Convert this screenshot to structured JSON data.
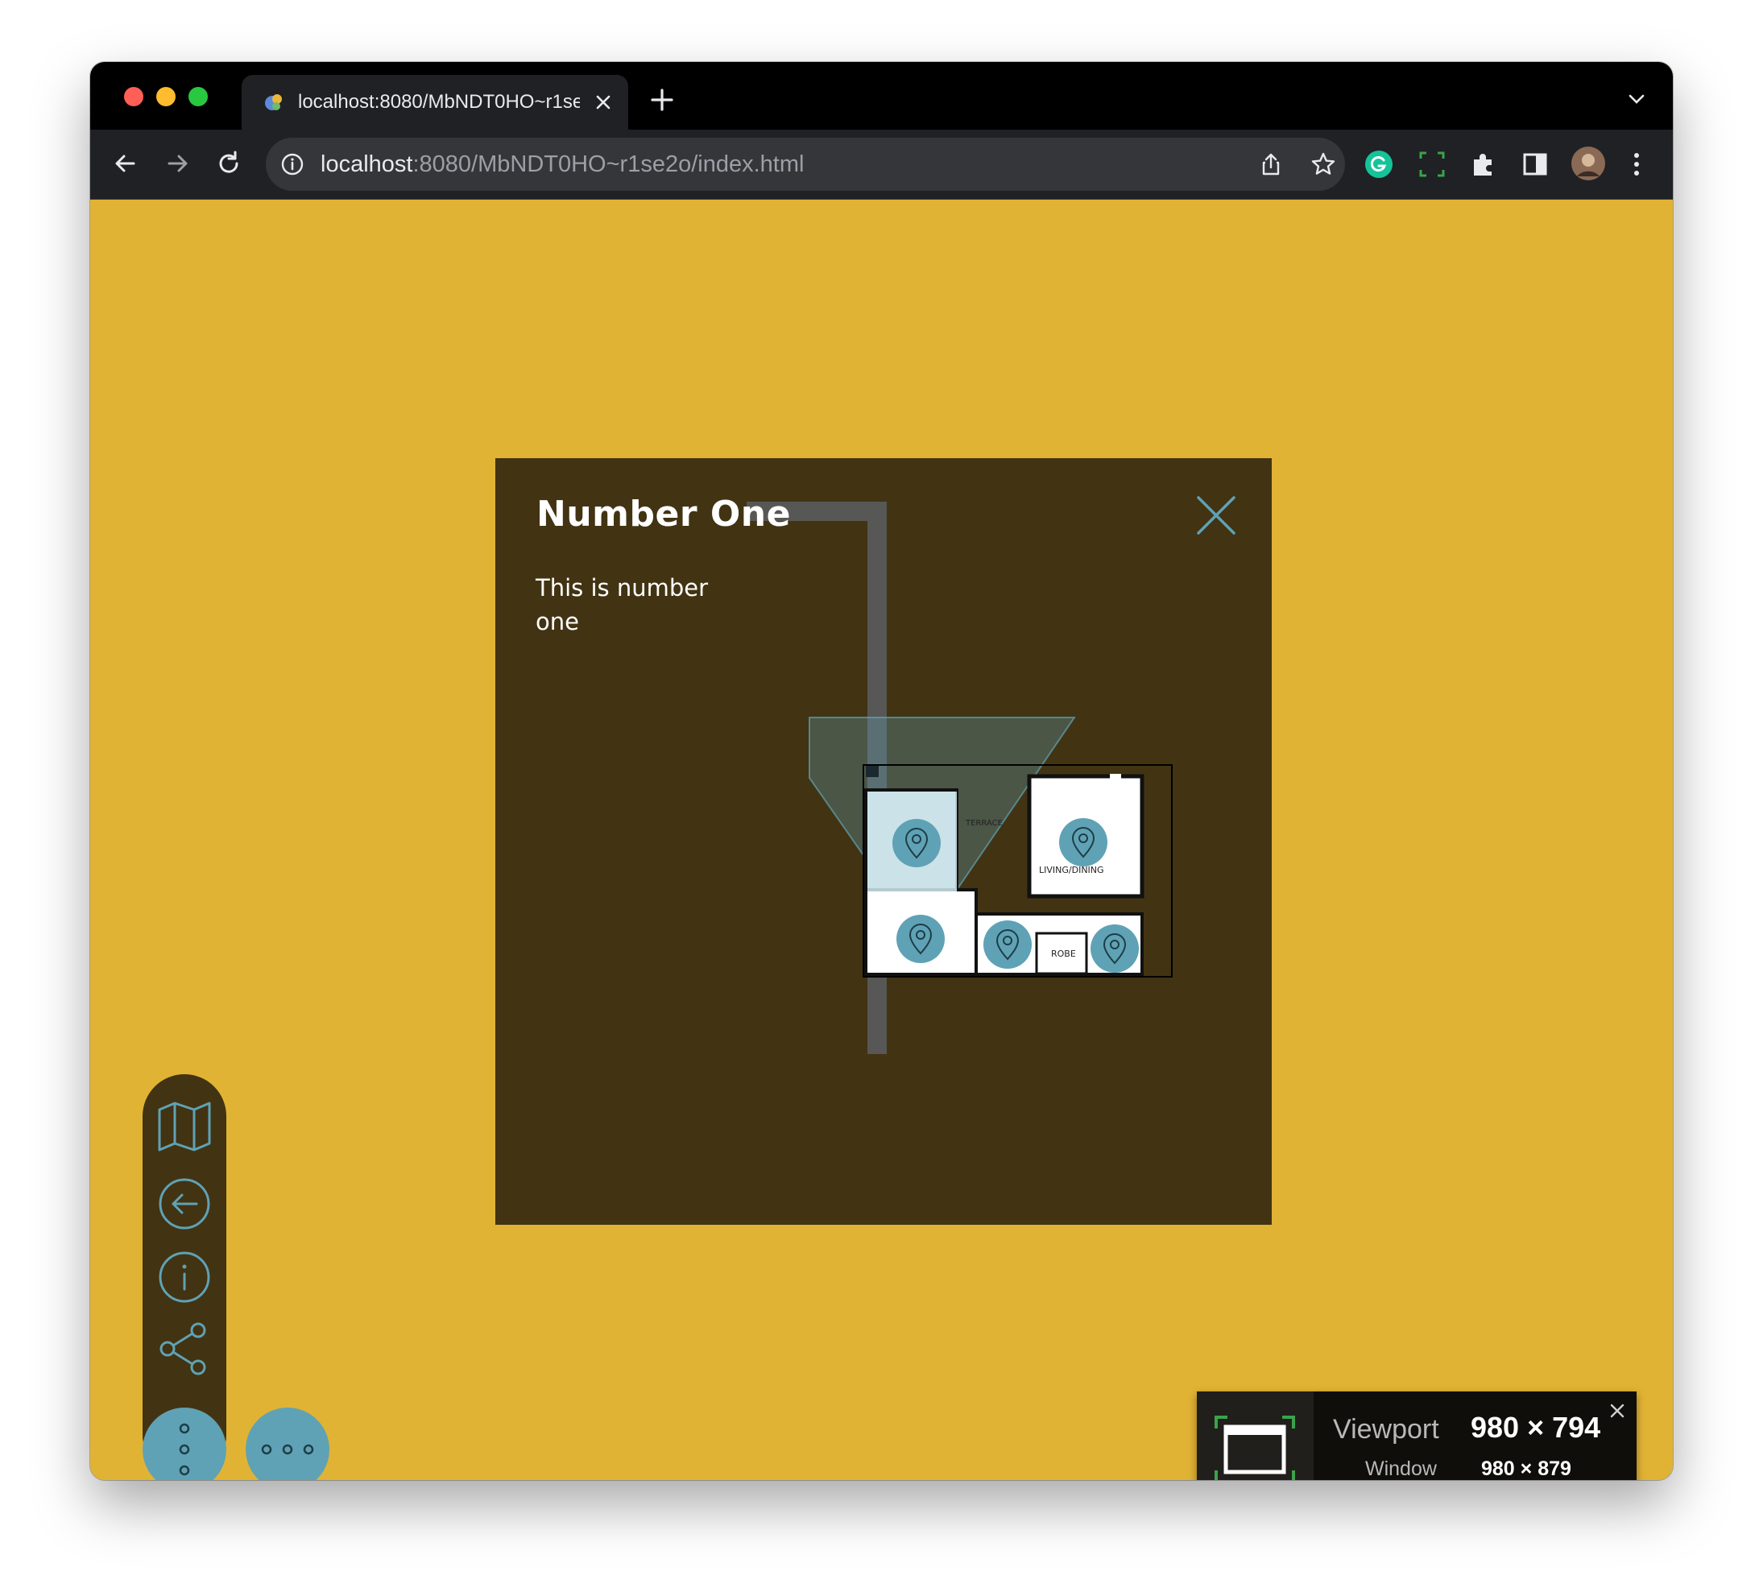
{
  "browser": {
    "tab_title": "localhost:8080/MbNDT0HO~r1se2o/index.html",
    "url_host": "localhost",
    "url_rest": ":8080/MbNDT0HO~r1se2o/index.html"
  },
  "colors": {
    "page_background": "#e1b334",
    "panel_background": "#423313",
    "accent": "#5fa2b5"
  },
  "modal": {
    "title": "Number One",
    "description": "This is number one",
    "close_icon": "close-icon"
  },
  "floorplan": {
    "rooms": [
      "TERRACE",
      "LIVING/DINING",
      "ROBE"
    ],
    "hotspot_count": 5
  },
  "sidenav": {
    "icons": [
      "map-icon",
      "back-arrow-icon",
      "info-icon",
      "share-icon"
    ],
    "fab_vertical_icon": "more-vertical-icon",
    "fab_horizontal_icon": "more-horizontal-icon"
  },
  "viewport_widget": {
    "viewport_label": "Viewport",
    "viewport_value": "980 × 794",
    "window_label": "Window",
    "window_value": "980 × 879"
  }
}
